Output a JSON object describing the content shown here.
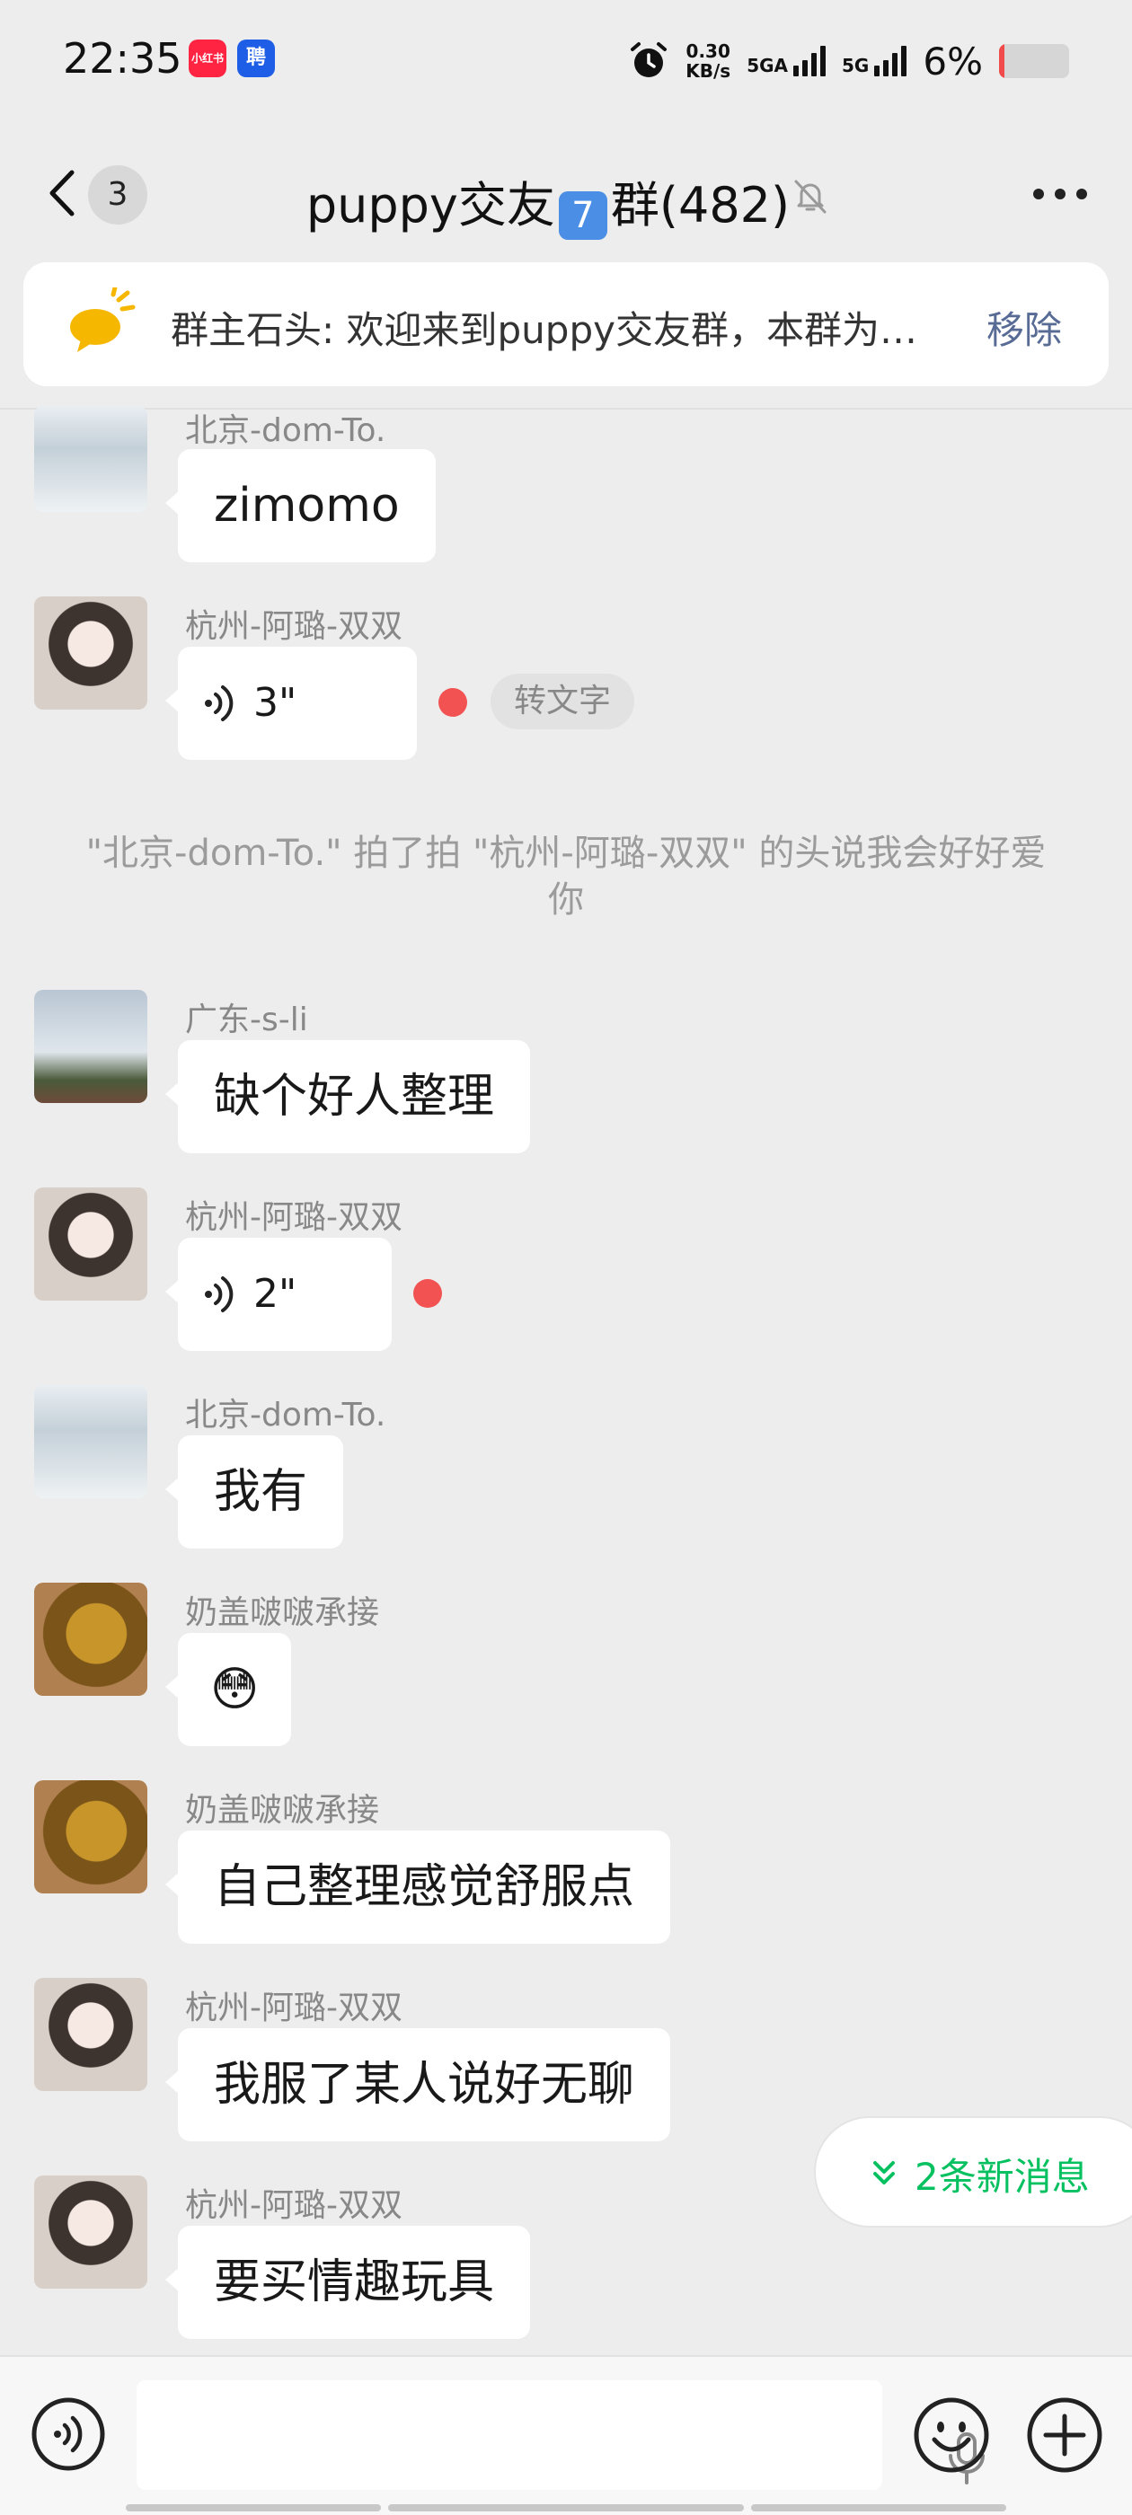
{
  "status_bar": {
    "time": "22:35",
    "app_badge_1": "小红书",
    "app_badge_2": "聘",
    "net_speed_value": "0.30",
    "net_speed_unit": "KB/s",
    "sim1": "5GA",
    "sim2": "5G",
    "battery_percent": "6%",
    "battery_level": 0.06,
    "battery_color": "#f04a4a"
  },
  "nav": {
    "unread_count": "3",
    "title_prefix": "puppy交友",
    "title_emoji": "7",
    "title_suffix": "群(482)"
  },
  "notice": {
    "text": "群主石头: 欢迎来到puppy交友群，本群为…",
    "remove_label": "移除"
  },
  "messages": [
    {
      "sender": "北京-dom-To.",
      "text": "zimomo",
      "avatar": "snow-walk-avatar"
    },
    {
      "sender": "杭州-阿璐-双双",
      "duration": "3\"",
      "to_text": "转文字",
      "avatar": "girl-avatar"
    },
    {
      "sender": "广东-s-li",
      "text": "缺个好人整理",
      "avatar": "lighthouse-avatar"
    },
    {
      "sender": "杭州-阿璐-双双",
      "duration": "2\"",
      "avatar": "girl-avatar"
    },
    {
      "sender": "北京-dom-To.",
      "text": "我有",
      "avatar": "snow-walk-avatar"
    },
    {
      "sender": "奶盖啵啵承接",
      "text": "😳",
      "avatar": "horse-avatar"
    },
    {
      "sender": "奶盖啵啵承接",
      "text": "自己整理感觉舒服点",
      "avatar": "horse-avatar"
    },
    {
      "sender": "杭州-阿璐-双双",
      "text": "我服了某人说好无聊",
      "avatar": "girl-avatar"
    },
    {
      "sender": "杭州-阿璐-双双",
      "text": "要买情趣玩具",
      "avatar": "girl-avatar"
    }
  ],
  "system_message": "\"北京-dom-To.\" 拍了拍 \"杭州-阿璐-双双\" 的头说我会好好爱你",
  "new_messages_label": "2条新消息",
  "colors": {
    "accent_green": "#07c160",
    "link_blue": "#576b95",
    "unread_red": "#f25252",
    "background": "#ededed"
  }
}
